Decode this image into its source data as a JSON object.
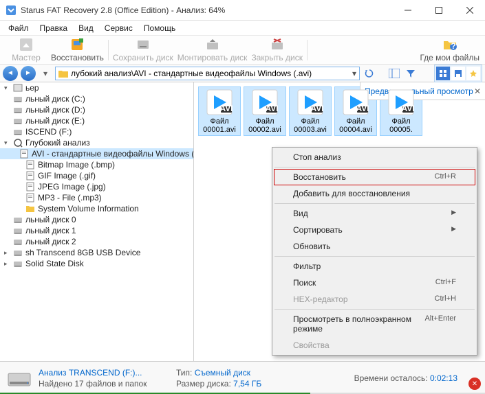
{
  "window": {
    "title": "Starus FAT Recovery 2.8 (Office Edition) - Анализ: 64%"
  },
  "menu": {
    "items": [
      "Файл",
      "Правка",
      "Вид",
      "Сервис",
      "Помощь"
    ]
  },
  "toolbar": {
    "items": [
      {
        "label": "Мастер",
        "disabled": true
      },
      {
        "label": "Восстановить",
        "disabled": false
      },
      {
        "label": "Сохранить диск",
        "disabled": true
      },
      {
        "label": "Монтировать диск",
        "disabled": true
      },
      {
        "label": "Закрыть диск",
        "disabled": true
      },
      {
        "label": "Где мои файлы",
        "disabled": false
      }
    ]
  },
  "address": {
    "path": "лубокий анализ\\AVI - стандартные видеофайлы Windows (.avi)"
  },
  "tree": [
    "ьер",
    "льный диск (C:)",
    "льный диск (D:)",
    "льный диск (E:)",
    "ISCEND (F:)",
    "Глубокий анализ",
    "AVI - стандартные видеофайлы Windows (.avi)",
    "Bitmap Image (.bmp)",
    "GIF Image (.gif)",
    "JPEG Image (.jpg)",
    "MP3 - File (.mp3)",
    "System Volume Information",
    "льный диск 0",
    "льный диск 1",
    "льный диск 2",
    "sh Transcend 8GB USB Device",
    "Solid State Disk"
  ],
  "files": [
    {
      "line1": "Файл",
      "line2": "00001.avi"
    },
    {
      "line1": "Файл",
      "line2": "00002.avi"
    },
    {
      "line1": "Файл",
      "line2": "00003.avi"
    },
    {
      "line1": "Файл",
      "line2": "00004.avi"
    },
    {
      "line1": "Файл",
      "line2": "00005."
    }
  ],
  "preview": {
    "title": "Предварительный просмотр"
  },
  "context_menu": [
    {
      "label": "Стоп анализ",
      "type": "item"
    },
    {
      "type": "sep"
    },
    {
      "label": "Восстановить",
      "shortcut": "Ctrl+R",
      "type": "item",
      "highlighted": true
    },
    {
      "label": "Добавить для восстановления",
      "type": "item"
    },
    {
      "type": "sep"
    },
    {
      "label": "Вид",
      "type": "submenu"
    },
    {
      "label": "Сортировать",
      "type": "submenu"
    },
    {
      "label": "Обновить",
      "type": "item"
    },
    {
      "type": "sep"
    },
    {
      "label": "Фильтр",
      "type": "item"
    },
    {
      "label": "Поиск",
      "shortcut": "Ctrl+F",
      "type": "item"
    },
    {
      "label": "HEX-редактор",
      "shortcut": "Ctrl+H",
      "type": "item",
      "disabled": true
    },
    {
      "type": "sep"
    },
    {
      "label": "Просмотреть в полноэкранном режиме",
      "shortcut": "Alt+Enter",
      "type": "item"
    },
    {
      "label": "Свойства",
      "type": "item",
      "disabled": true
    }
  ],
  "status": {
    "analysis_label": "Анализ TRANSCEND (F:)...",
    "found_label": "Найдено 17 файлов и папок",
    "type_label": "Тип:",
    "type_value": "Съемный диск",
    "size_label": "Размер диска:",
    "size_value": "7,54 ГБ",
    "time_label": "Времени осталось:",
    "time_value": "0:02:13"
  }
}
